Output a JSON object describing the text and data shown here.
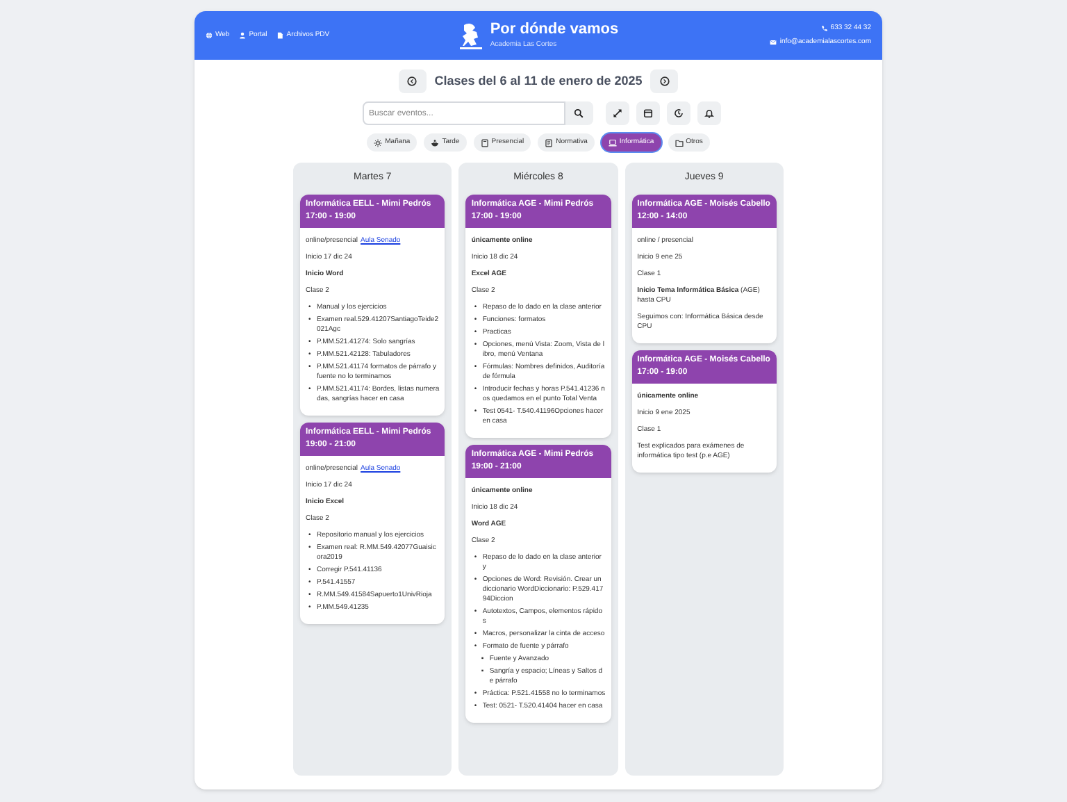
{
  "header": {
    "links": [
      {
        "kind": "globe",
        "label": "Web"
      },
      {
        "kind": "user",
        "label": "Portal"
      },
      {
        "kind": "file",
        "label": "Archivos PDV"
      }
    ],
    "title": "Por dónde vamos",
    "subtitle": "Academia Las Cortes",
    "contacts": [
      {
        "kind": "phone",
        "label": "633 32 44 32"
      },
      {
        "kind": "mail",
        "label": "info@academialascortes.com"
      }
    ]
  },
  "week": {
    "title": "Clases del 6 al 11 de enero de 2025"
  },
  "search": {
    "placeholder": "Buscar eventos..."
  },
  "tools": [
    {
      "kind": "expand"
    },
    {
      "kind": "calendar"
    },
    {
      "kind": "clock"
    },
    {
      "kind": "bell"
    }
  ],
  "filters": [
    {
      "kind": "sun",
      "label": "Mañana",
      "selected": false
    },
    {
      "kind": "bowl",
      "label": "Tarde",
      "selected": false
    },
    {
      "kind": "book",
      "label": "Presencial",
      "selected": false
    },
    {
      "kind": "doc",
      "label": "Normativa",
      "selected": false
    },
    {
      "kind": "laptop",
      "label": "Informática",
      "selected": true
    },
    {
      "kind": "folder",
      "label": "Otros",
      "selected": false
    }
  ],
  "days": [
    {
      "title": "Martes 7",
      "events": [
        {
          "title": "Informática EELL - Mimi Pedrós",
          "time": "17:00 - 19:00",
          "blocks": [
            {
              "kind": "link_line",
              "text": "online/presencial",
              "link": "Aula Senado"
            },
            {
              "kind": "text",
              "text": "Inicio 17 dic 24"
            },
            {
              "kind": "strong",
              "text": "Inicio Word"
            },
            {
              "kind": "text",
              "text": "Clase 2"
            },
            {
              "kind": "list",
              "marker": "•",
              "items": [
                {
                  "text": "Manual y los ejercicios"
                },
                {
                  "text": "Examen real.529.41207SantiagoTeide2021Agc"
                },
                {
                  "text": "P.MM.521.41274: Solo sangrías"
                },
                {
                  "text": "P.MM.521.42128: Tabuladores"
                },
                {
                  "text": "P.MM.521.41174 formatos de párrafo y fuente no lo terminamos"
                },
                {
                  "text": "P.MM.521.41174: Bordes, listas numeradas, sangrías hacer en casa"
                }
              ]
            }
          ]
        },
        {
          "title": "Informática EELL - Mimi Pedrós",
          "time": "19:00 - 21:00",
          "blocks": [
            {
              "kind": "link_line",
              "text": "online/presencial",
              "link": "Aula Senado"
            },
            {
              "kind": "text",
              "text": "Inicio 17 dic 24"
            },
            {
              "kind": "strong",
              "text": "Inicio Excel"
            },
            {
              "kind": "text",
              "text": "Clase 2"
            },
            {
              "kind": "list",
              "marker": "•",
              "items": [
                {
                  "text": "Repositorio manual y los ejercicios"
                },
                {
                  "text": "Examen real: R.MM.549.42077Guaisicora2019"
                },
                {
                  "text": "Corregir P.541.41136"
                },
                {
                  "text": "P.541.41557"
                },
                {
                  "text": "R.MM.549.41584Sapuerto1UnivRioja"
                },
                {
                  "text": "P.MM.549.41235"
                }
              ]
            }
          ]
        }
      ]
    },
    {
      "title": "Miércoles 8",
      "events": [
        {
          "title": "Informática AGE - Mimi Pedrós",
          "time": "17:00 - 19:00",
          "blocks": [
            {
              "kind": "strong",
              "text": "únicamente online"
            },
            {
              "kind": "text",
              "text": "Inicio 18 dic 24"
            },
            {
              "kind": "strong",
              "text": "Excel AGE"
            },
            {
              "kind": "text",
              "text": "Clase 2"
            },
            {
              "kind": "list",
              "marker": "•",
              "items": [
                {
                  "text": "Repaso de lo dado en la clase anterior"
                },
                {
                  "text": "Funciones: formatos"
                },
                {
                  "text": "Practicas"
                },
                {
                  "text": "Opciones, menú Vista: Zoom, Vista de libro, menú Ventana"
                },
                {
                  "text": "Fórmulas: Nombres definidos, Auditoría de fórmula"
                },
                {
                  "text": "Introducir fechas y horas P.541.41236 nos quedamos en el punto Total Venta"
                },
                {
                  "text": "Test 0541- T.540.41196Opciones hacer en casa"
                }
              ]
            }
          ]
        },
        {
          "title": "Informática AGE - Mimi Pedrós",
          "time": "19:00 - 21:00",
          "blocks": [
            {
              "kind": "strong",
              "text": "únicamente online"
            },
            {
              "kind": "text",
              "text": "Inicio 18 dic 24"
            },
            {
              "kind": "strong",
              "text": "Word AGE"
            },
            {
              "kind": "text",
              "text": "Clase 2"
            },
            {
              "kind": "list",
              "marker": "•",
              "items": [
                {
                  "text": "Repaso de lo dado en la clase anterior y"
                },
                {
                  "text": "Opciones de Word: Revisión. Crear un diccionario WordDiccionario: P.529.41794Diccion"
                },
                {
                  "text": "Autotextos, Campos, elementos rápidos"
                },
                {
                  "text": "Macros, personalizar la cinta de acceso"
                },
                {
                  "text": "Formato de fuente y párrafo",
                  "children_marker": "▪",
                  "children": [
                    {
                      "text": "Fuente y Avanzado"
                    },
                    {
                      "text": "Sangría y espacio; Líneas y Saltos de párrafo"
                    }
                  ]
                },
                {
                  "text": "Práctica: P.521.41558 no lo terminamos"
                },
                {
                  "text": "Test: 0521- T.520.41404 hacer en casa"
                }
              ]
            }
          ]
        }
      ]
    },
    {
      "title": "Jueves 9",
      "events": [
        {
          "title": "Informática AGE - Moisés Cabello",
          "time": "12:00 - 14:00",
          "blocks": [
            {
              "kind": "text",
              "text": "online / presencial"
            },
            {
              "kind": "text",
              "text": "Inicio 9 ene 25"
            },
            {
              "kind": "text",
              "text": "Clase 1"
            },
            {
              "kind": "rich",
              "text": "**Inicio Tema Informática Básica** (AGE) hasta CPU"
            },
            {
              "kind": "text",
              "text": "Seguimos con: Informática Básica desde CPU"
            }
          ]
        },
        {
          "title": "Informática AGE - Moisés Cabello",
          "time": "17:00 - 19:00",
          "blocks": [
            {
              "kind": "strong",
              "text": "únicamente online"
            },
            {
              "kind": "text",
              "text": "Inicio 9 ene 2025"
            },
            {
              "kind": "text",
              "text": "Clase 1"
            },
            {
              "kind": "text",
              "text": "Test explicados para exámenes de informática tipo test (p.e AGE)"
            }
          ]
        }
      ]
    }
  ]
}
